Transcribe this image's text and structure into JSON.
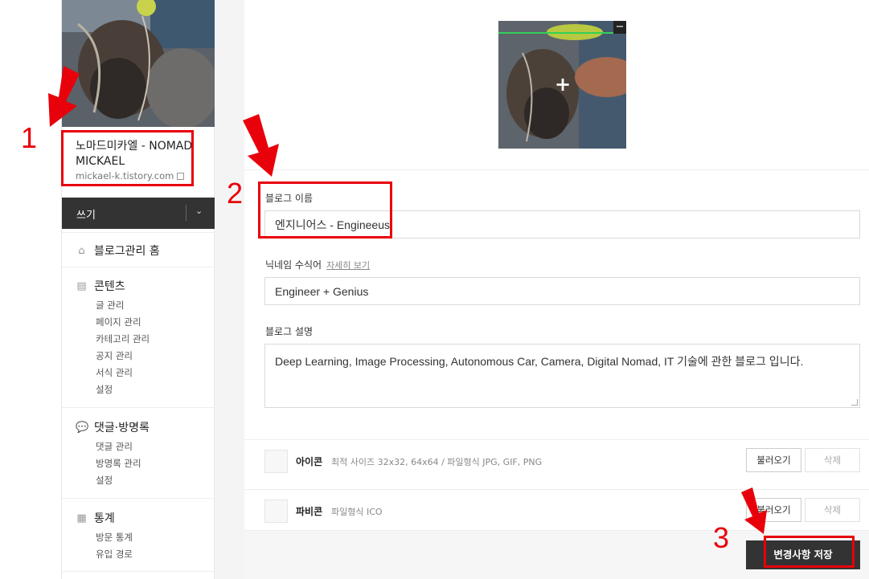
{
  "sidebar": {
    "blog_title": "노마드미카엘 - NOMAD MICKAEL",
    "blog_url": "mickael-k.tistory.com",
    "write_label": "쓰기",
    "home_label": "블로그관리 홈",
    "sections": [
      {
        "title": "콘텐츠",
        "items": [
          "글 관리",
          "페이지 관리",
          "카테고리 관리",
          "공지 관리",
          "서식 관리",
          "설정"
        ]
      },
      {
        "title": "댓글·방명록",
        "items": [
          "댓글 관리",
          "방명록 관리",
          "설정"
        ]
      },
      {
        "title": "통계",
        "items": [
          "방문 통계",
          "유입 경로"
        ]
      }
    ]
  },
  "form": {
    "blog_name_label": "블로그 이름",
    "blog_name_value": "엔지니어스 - Engineeus",
    "nickname_label": "닉네임 수식어",
    "nickname_link": "자세히 보기",
    "nickname_value": "Engineer + Genius",
    "desc_label": "블로그 설명",
    "desc_value": "Deep Learning, Image Processing, Autonomous Car, Camera, Digital Nomad, IT 기술에 관한 블로그 입니다.",
    "icon_label": "아이콘",
    "icon_hint": "최적 사이즈 32x32, 64x64 / 파일형식 JPG, GIF, PNG",
    "favicon_label": "파비콘",
    "favicon_hint": "파일형식 ICO",
    "load_label": "불러오기",
    "delete_label": "삭제",
    "save_label": "변경사항 저장"
  },
  "annotations": {
    "n1": "1",
    "n2": "2",
    "n3": "3",
    "color": "#e8000b"
  },
  "colors": {
    "dark_button": "#333333",
    "background": "#f4f4f4"
  }
}
